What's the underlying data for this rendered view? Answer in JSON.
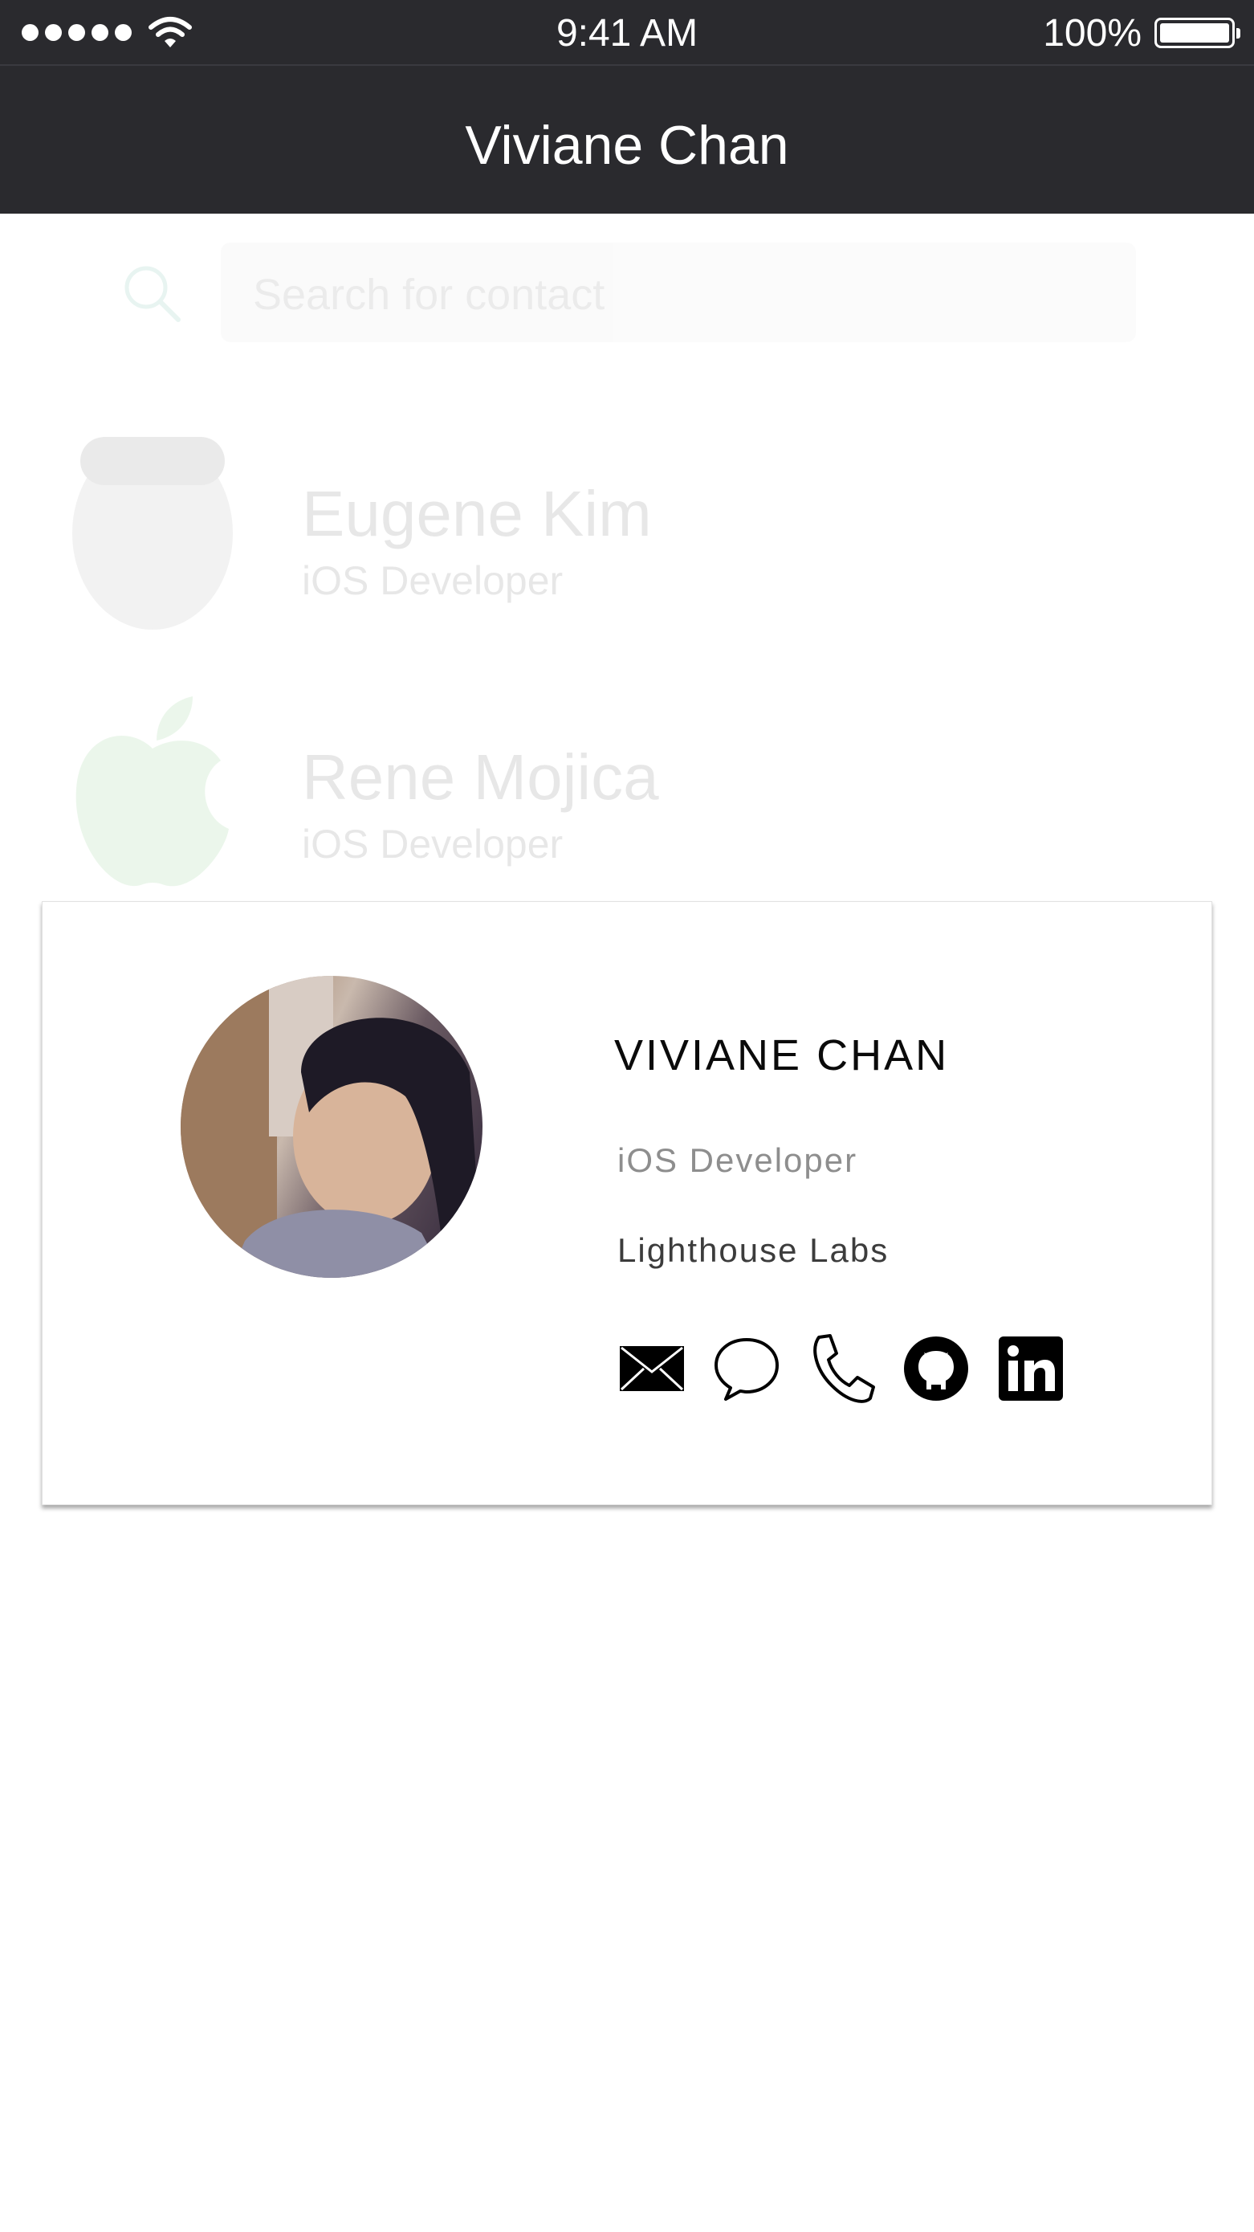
{
  "status_bar": {
    "time": "9:41 AM",
    "battery": "100%"
  },
  "nav": {
    "title": "Viviane Chan"
  },
  "search": {
    "placeholder": "Search for contact"
  },
  "contacts": [
    {
      "name": "Eugene Kim",
      "role": "iOS Developer",
      "avatar": "person-photo"
    },
    {
      "name": "Rene Mojica",
      "role": "iOS Developer",
      "avatar": "apple-logo"
    }
  ],
  "card": {
    "name": "VIVIANE CHAN",
    "role": "iOS Developer",
    "company": "Lighthouse Labs",
    "actions": [
      "email-icon",
      "message-icon",
      "phone-icon",
      "github-icon",
      "linkedin-icon"
    ]
  },
  "colors": {
    "nav_background": "#2a2a2e",
    "card_background": "#ffffff",
    "role_text": "#8e8e8e"
  }
}
